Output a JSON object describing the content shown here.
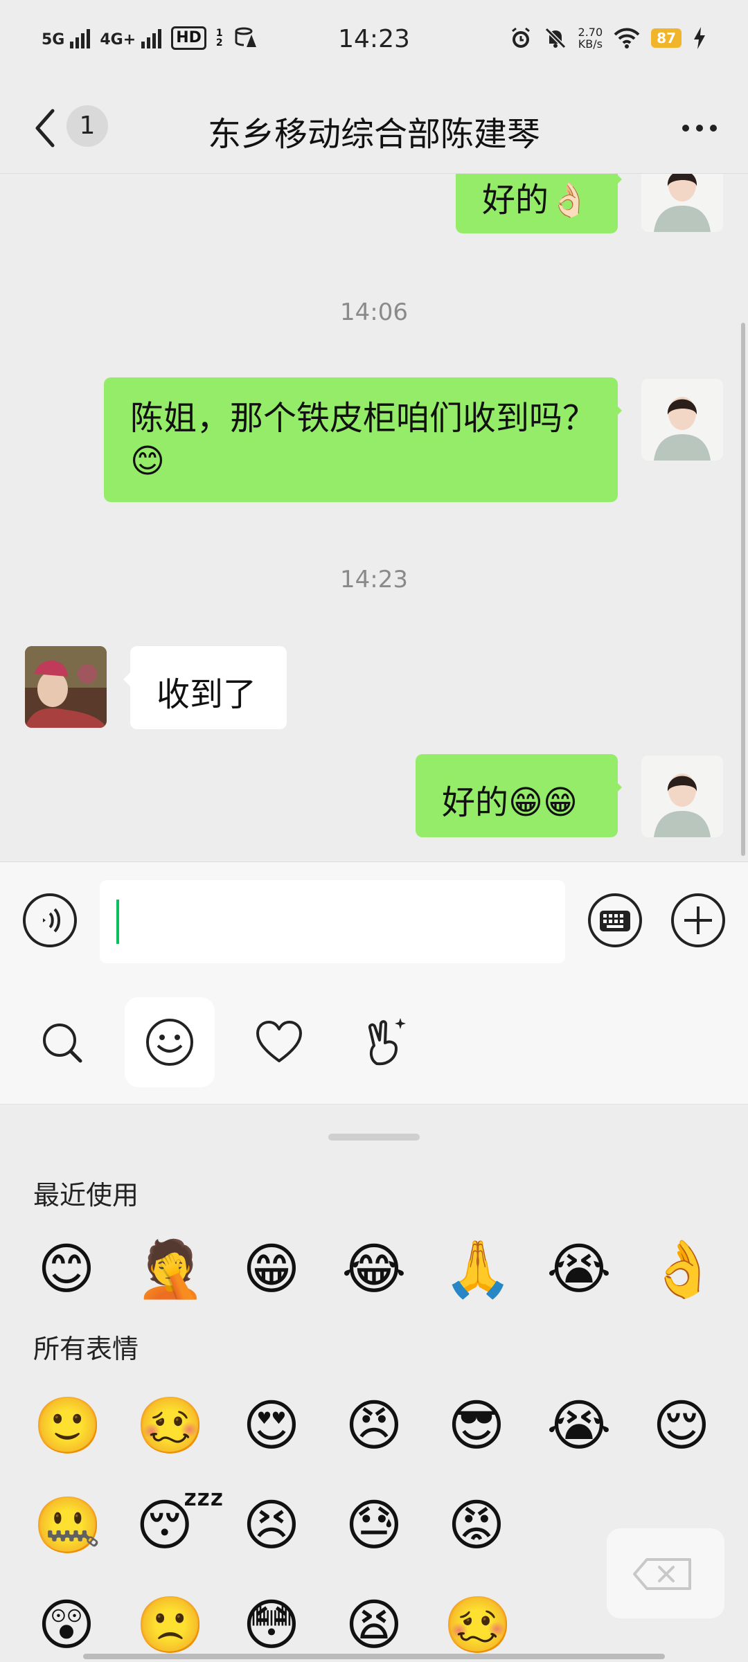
{
  "status": {
    "signals": [
      "5G",
      "4G+"
    ],
    "hd": "HD",
    "hd_sub": "1 2",
    "time": "14:23",
    "net_speed_value": "2.70",
    "net_speed_unit": "KB/s",
    "battery": "87"
  },
  "header": {
    "back_badge": "1",
    "title": "东乡移动综合部陈建琴"
  },
  "messages": [
    {
      "side": "out",
      "text": "好的👌🏻"
    },
    {
      "type": "timestamp",
      "text": "14:06"
    },
    {
      "side": "out",
      "text": "陈姐，那个铁皮柜咱们收到吗？😊"
    },
    {
      "type": "timestamp",
      "text": "14:23"
    },
    {
      "side": "in",
      "text": "收到了"
    },
    {
      "side": "out",
      "text": "好的😁😁"
    }
  ],
  "input": {
    "value": ""
  },
  "emoji_panel": {
    "recent_label": "最近使用",
    "all_label": "所有表情",
    "recent": [
      "😊",
      "🤦",
      "😁",
      "😂",
      "🙏",
      "😭",
      "👌"
    ],
    "all_row1": [
      "🙂",
      "🥴",
      "😍",
      "😠",
      "😎",
      "😭",
      "😌"
    ],
    "all_row2": [
      "🤐",
      "😴",
      "😣",
      "😓",
      "😡"
    ],
    "all_row3": [
      "😲",
      "🙁",
      "😳",
      "😫",
      "🥴"
    ]
  },
  "icons": {
    "back": "chevron-left-icon",
    "more": "more-dots-icon",
    "voice": "voice-icon",
    "keyboard": "keyboard-icon",
    "plus": "plus-icon",
    "search": "search-icon",
    "emoji": "emoji-icon",
    "heart": "heart-icon",
    "sticker": "hand-gesture-icon",
    "delete": "backspace-icon"
  },
  "colors": {
    "outgoing_bubble": "#95ec69",
    "incoming_bubble": "#ffffff",
    "cursor": "#07c160",
    "battery": "#f1b52b"
  }
}
